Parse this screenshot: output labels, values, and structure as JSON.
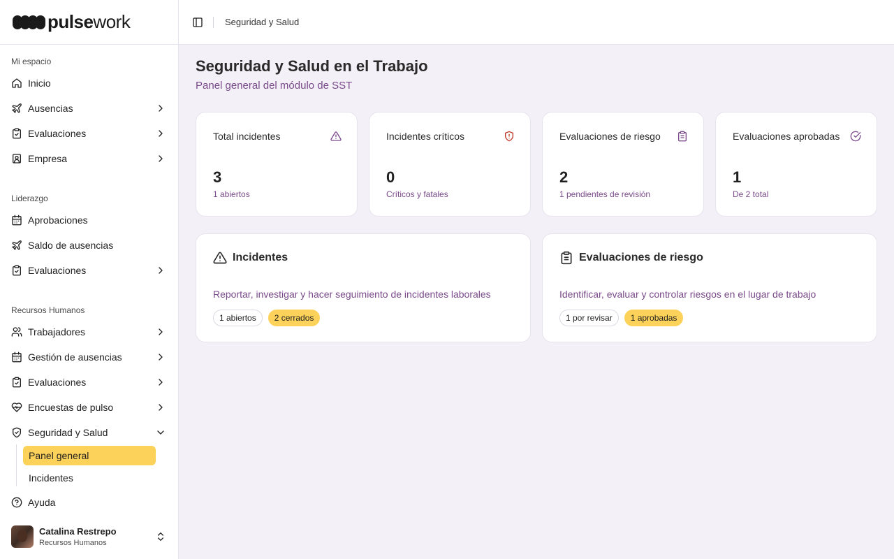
{
  "brand": {
    "bold": "pulse",
    "light": "work"
  },
  "sidebar": {
    "sections": {
      "mi_espacio": "Mi espacio",
      "liderazgo": "Liderazgo",
      "rrhh": "Recursos Humanos"
    },
    "items": [
      {
        "label": "Inicio",
        "icon": "home-icon"
      },
      {
        "label": "Ausencias",
        "icon": "plane-icon"
      },
      {
        "label": "Evaluaciones",
        "icon": "clipboard-check-icon"
      },
      {
        "label": "Empresa",
        "icon": "badge-icon"
      },
      {
        "label": "Aprobaciones",
        "icon": "calendar-icon"
      },
      {
        "label": "Saldo de ausencias",
        "icon": "plane-icon"
      },
      {
        "label": "Evaluaciones",
        "icon": "clipboard-check-icon"
      },
      {
        "label": "Trabajadores",
        "icon": "users-icon"
      },
      {
        "label": "Gestión de ausencias",
        "icon": "calendar-icon"
      },
      {
        "label": "Evaluaciones",
        "icon": "clipboard-check-icon"
      },
      {
        "label": "Encuestas de pulso",
        "icon": "heart-pulse-icon"
      },
      {
        "label": "Seguridad y Salud",
        "icon": "shield-check-icon"
      },
      {
        "label": "Ayuda",
        "icon": "help-icon"
      }
    ],
    "subitems": [
      {
        "label": "Panel general"
      },
      {
        "label": "Incidentes"
      }
    ],
    "user": {
      "name": "Catalina Restrepo",
      "role": "Recursos Humanos"
    }
  },
  "header": {
    "breadcrumb": "Seguridad y Salud"
  },
  "main": {
    "title": "Seguridad y Salud en el Trabajo",
    "subtitle": "Panel general del módulo de SST",
    "stats": [
      {
        "title": "Total incidentes",
        "value": "3",
        "desc": "1 abiertos",
        "icon": "alert-triangle-icon"
      },
      {
        "title": "Incidentes críticos",
        "value": "0",
        "desc": "Críticos y fatales",
        "icon": "shield-alert-icon"
      },
      {
        "title": "Evaluaciones de riesgo",
        "value": "2",
        "desc": "1 pendientes de revisión",
        "icon": "clipboard-list-icon"
      },
      {
        "title": "Evaluaciones aprobadas",
        "value": "1",
        "desc": "De 2 total",
        "icon": "circle-check-icon"
      }
    ],
    "modules": [
      {
        "title": "Incidentes",
        "desc": "Reportar, investigar y hacer seguimiento de incidentes laborales",
        "badge1": "1 abiertos",
        "badge2": "2 cerrados"
      },
      {
        "title": "Evaluaciones de riesgo",
        "desc": "Identificar, evaluar y controlar riesgos en el lugar de trabajo",
        "badge1": "1 por revisar",
        "badge2": "1 aprobadas"
      }
    ]
  },
  "colors": {
    "accent": "#fcd25a",
    "purple": "#7a4a8a",
    "danger": "#c0392b"
  }
}
